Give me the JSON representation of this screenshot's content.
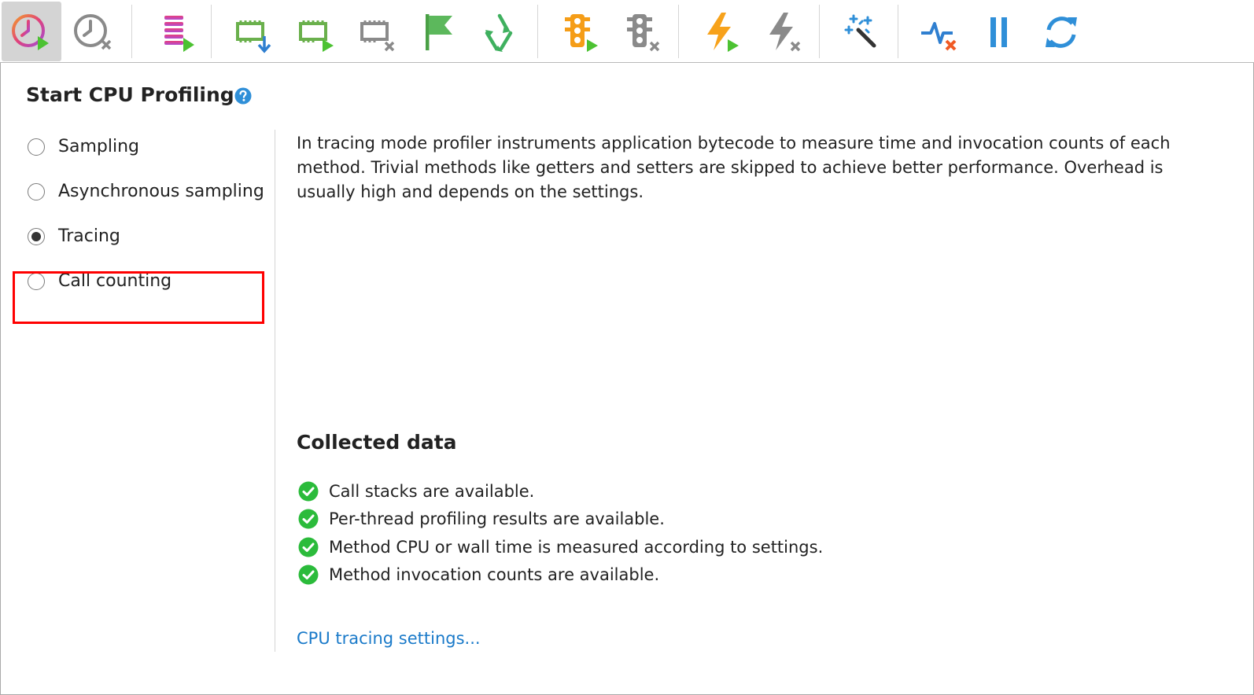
{
  "toolbar": {
    "buttons": [
      {
        "icon": "start-cpu-profiling-icon",
        "active": true
      },
      {
        "icon": "stop-cpu-profiling-icon"
      },
      {
        "icon": "start-allocation-recording-icon"
      },
      {
        "icon": "capture-memory-snapshot-icon"
      },
      {
        "icon": "start-memory-recording-icon"
      },
      {
        "icon": "stop-memory-recording-icon"
      },
      {
        "icon": "advance-object-generation-icon"
      },
      {
        "icon": "force-garbage-collection-icon"
      },
      {
        "icon": "start-monitor-profiling-icon"
      },
      {
        "icon": "stop-monitor-profiling-icon"
      },
      {
        "icon": "start-exception-profiling-icon"
      },
      {
        "icon": "stop-exception-profiling-icon"
      },
      {
        "icon": "magic-wand-icon"
      },
      {
        "icon": "stop-telemetry-icon"
      },
      {
        "icon": "pause-icon"
      },
      {
        "icon": "refresh-icon"
      }
    ]
  },
  "panel": {
    "title": "Start CPU Profiling",
    "modes": [
      {
        "label": "Sampling",
        "selected": false
      },
      {
        "label": "Asynchronous sampling",
        "selected": false
      },
      {
        "label": "Tracing",
        "selected": true
      },
      {
        "label": "Call counting",
        "selected": false
      }
    ],
    "description": "In tracing mode profiler instruments application bytecode to measure time and invocation counts of each method. Trivial methods like getters and setters are skipped to achieve better performance. Overhead is usually high and depends on the settings.",
    "collected_title": "Collected data",
    "collected_items": [
      "Call stacks are available.",
      "Per-thread profiling results are available.",
      "Method CPU or wall time is measured according to settings.",
      "Method invocation counts are available."
    ],
    "settings_link": "CPU tracing settings..."
  },
  "colors": {
    "accent_link": "#1a7ac9",
    "highlight": "#ff0000",
    "check_green": "#2bbb3b",
    "help_blue": "#2f8fd8"
  }
}
